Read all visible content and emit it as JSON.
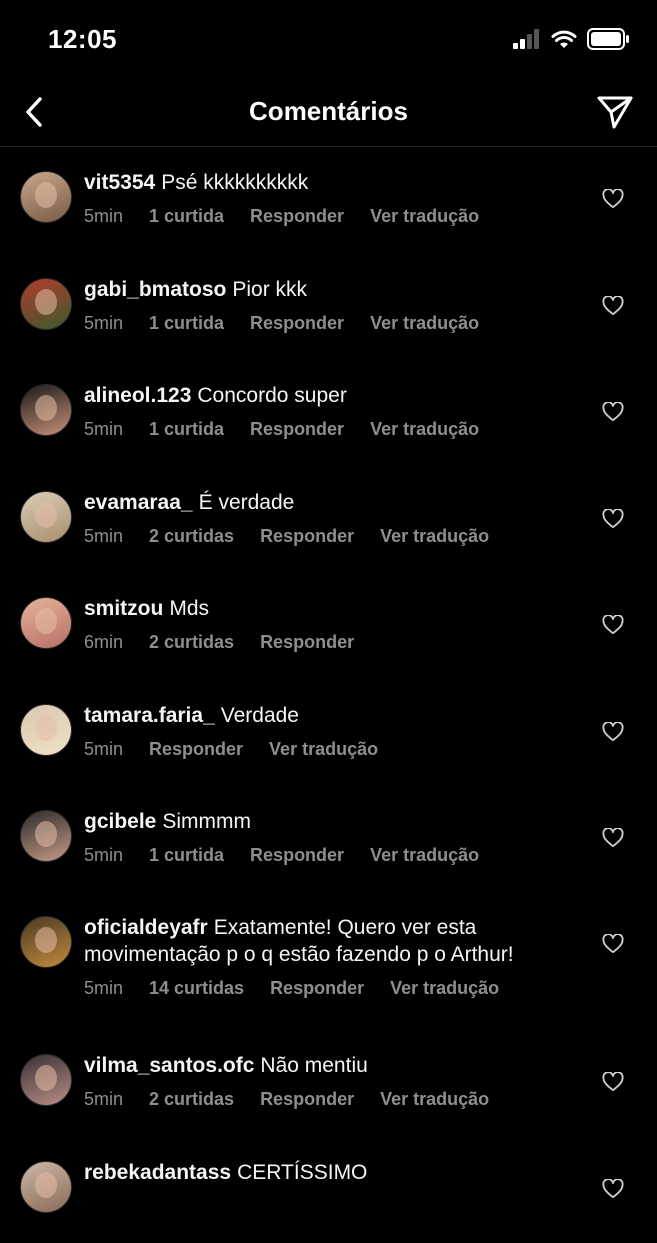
{
  "status": {
    "time": "12:05"
  },
  "header": {
    "title": "Comentários"
  },
  "comments": [
    {
      "user": "vit5354",
      "text": "Psé kkkkkkkkkk",
      "time": "5min",
      "likes": "1 curtida",
      "reply": "Responder",
      "translate": "Ver tradução",
      "avatar_colors": [
        "#c7a88c",
        "#7a5a44"
      ]
    },
    {
      "user": "gabi_bmatoso",
      "text": "Pior kkk",
      "time": "5min",
      "likes": "1 curtida",
      "reply": "Responder",
      "translate": "Ver tradução",
      "avatar_colors": [
        "#b13a2e",
        "#3d5a2a"
      ]
    },
    {
      "user": "alineol.123",
      "text": "Concordo super",
      "time": "5min",
      "likes": "1 curtida",
      "reply": "Responder",
      "translate": "Ver tradução",
      "avatar_colors": [
        "#1a1a1a",
        "#c9917a"
      ]
    },
    {
      "user": "evamaraa_",
      "text": "É verdade",
      "time": "5min",
      "likes": "2 curtidas",
      "reply": "Responder",
      "translate": "Ver tradução",
      "avatar_colors": [
        "#d8cdb8",
        "#a98e6c"
      ]
    },
    {
      "user": "smitzou",
      "text": "Mds",
      "time": "6min",
      "likes": "2 curtidas",
      "reply": "Responder",
      "translate": "",
      "avatar_colors": [
        "#e3b39c",
        "#b96f65"
      ]
    },
    {
      "user": "tamara.faria_",
      "text": "Verdade",
      "time": "5min",
      "likes": "",
      "reply": "Responder",
      "translate": "Ver tradução",
      "avatar_colors": [
        "#d9c7b0",
        "#efe2c5"
      ]
    },
    {
      "user": "gcibele",
      "text": "Simmmm",
      "time": "5min",
      "likes": "1 curtida",
      "reply": "Responder",
      "translate": "Ver tradução",
      "avatar_colors": [
        "#2b2b2b",
        "#c89b86"
      ]
    },
    {
      "user": "oficialdeyafr",
      "text": "Exatamente! Quero ver esta movimentação p o q estão fazendo p o Arthur!",
      "time": "5min",
      "likes": "14 curtidas",
      "reply": "Responder",
      "translate": "Ver tradução",
      "avatar_colors": [
        "#4b3b22",
        "#c18a3e"
      ]
    },
    {
      "user": "vilma_santos.ofc",
      "text": "Não mentiu",
      "time": "5min",
      "likes": "2 curtidas",
      "reply": "Responder",
      "translate": "Ver tradução",
      "avatar_colors": [
        "#3a3035",
        "#b98e85"
      ]
    },
    {
      "user": "rebekadantass",
      "text": "CERTÍSSIMO",
      "time": "",
      "likes": "",
      "reply": "",
      "translate": "",
      "avatar_colors": [
        "#cdb8a6",
        "#8a6a58"
      ]
    }
  ]
}
